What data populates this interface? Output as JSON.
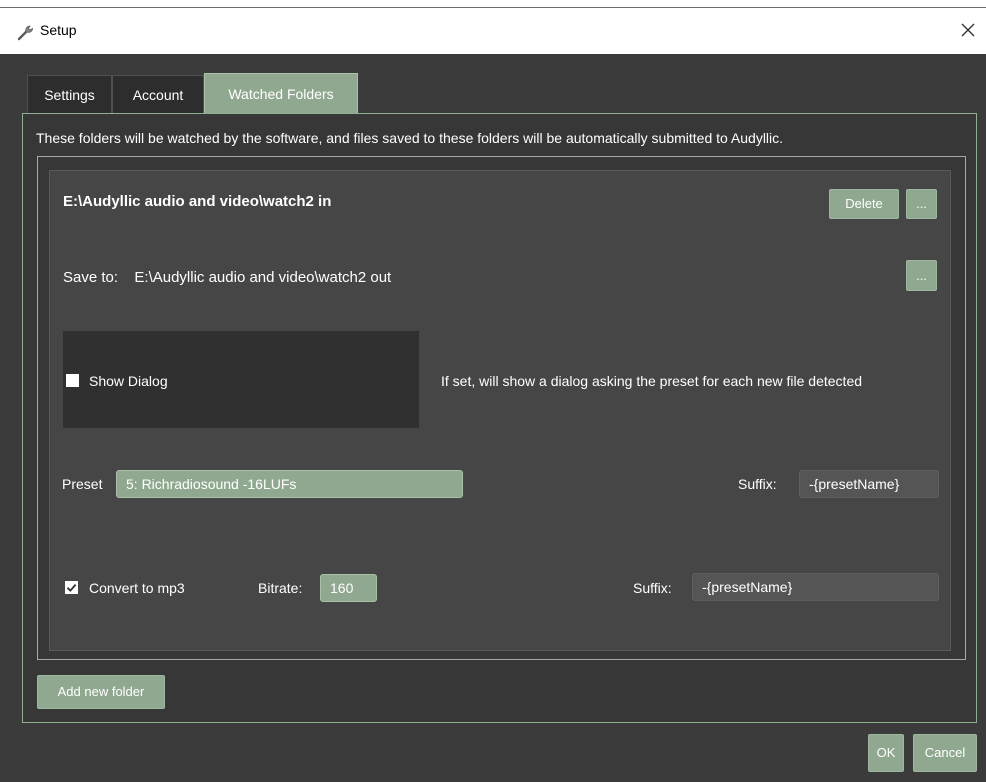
{
  "window": {
    "title": "Setup"
  },
  "tabs": [
    {
      "label": "Settings",
      "active": false
    },
    {
      "label": "Account",
      "active": false
    },
    {
      "label": "Watched Folders",
      "active": true
    }
  ],
  "description": "These folders will be watched by the software, and files saved to these folders will be automatically submitted to Audyllic.",
  "folder": {
    "path": "E:\\Audyllic audio and video\\watch2 in",
    "delete_label": "Delete",
    "more_label": "...",
    "save_to_label": "Save to:",
    "save_to_path": "E:\\Audyllic audio and video\\watch2 out",
    "save_to_browse_label": "...",
    "show_dialog_label": "Show Dialog",
    "show_dialog_checked": false,
    "show_dialog_hint": "If set, will show a dialog asking the preset for each new file detected",
    "preset_label": "Preset",
    "preset_value": "5: Richradiosound -16LUFs",
    "suffix_label": "Suffix:",
    "suffix_value": "-{presetName}",
    "convert_mp3_label": "Convert to mp3",
    "convert_mp3_checked": true,
    "bitrate_label": "Bitrate:",
    "bitrate_value": "160",
    "mp3_suffix_label": "Suffix:",
    "mp3_suffix_value": "-{presetName}"
  },
  "add_folder_label": "Add new folder",
  "footer": {
    "ok_label": "OK",
    "cancel_label": "Cancel"
  },
  "colors": {
    "accent_green": "#8fa88f",
    "background": "#3b3b3b",
    "card": "#464646"
  }
}
